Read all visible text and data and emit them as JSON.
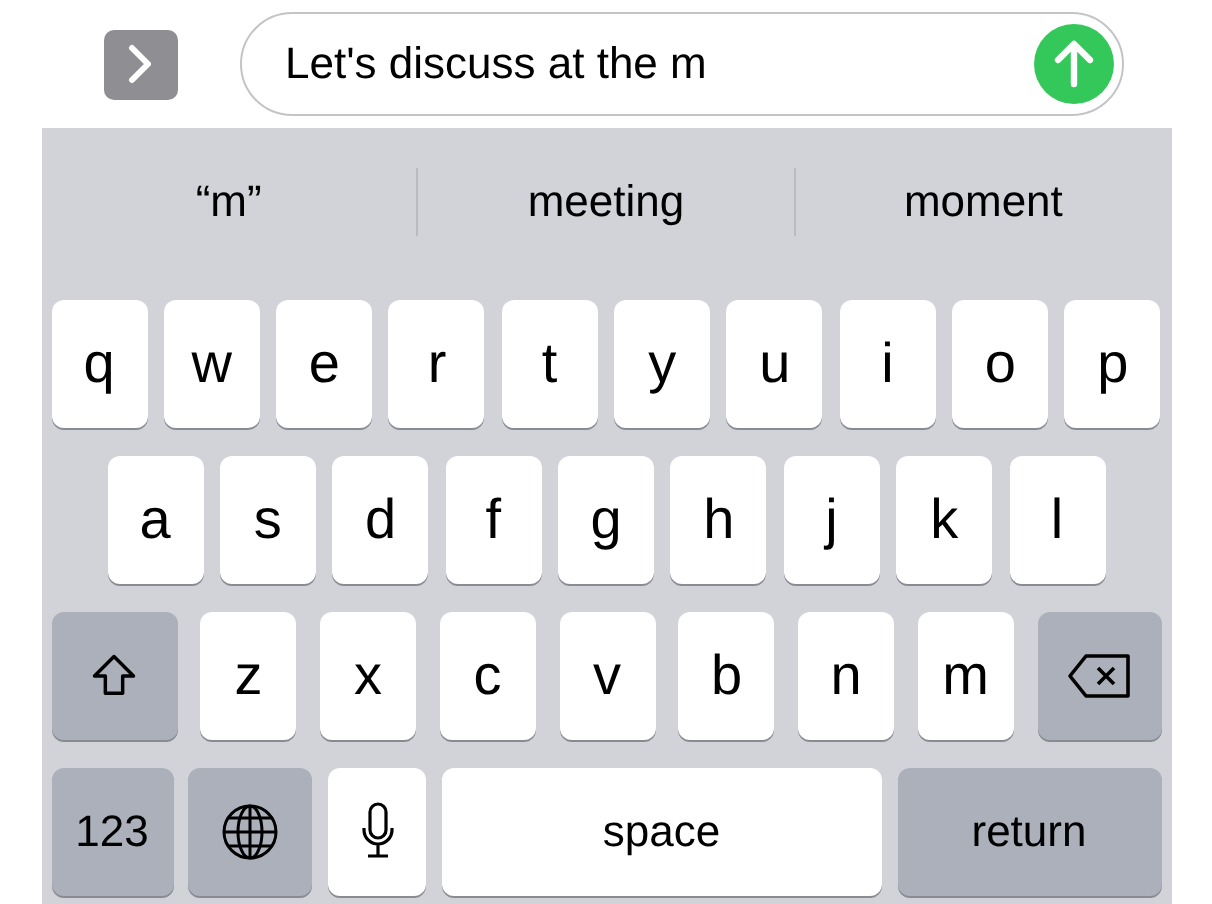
{
  "message_field": {
    "value": "Let's discuss at the m"
  },
  "suggestions": [
    {
      "label": "“m”"
    },
    {
      "label": "meeting"
    },
    {
      "label": "moment"
    }
  ],
  "keyboard_rows": [
    [
      {
        "kind": "letter",
        "label": "q"
      },
      {
        "kind": "letter",
        "label": "w"
      },
      {
        "kind": "letter",
        "label": "e"
      },
      {
        "kind": "letter",
        "label": "r"
      },
      {
        "kind": "letter",
        "label": "t"
      },
      {
        "kind": "letter",
        "label": "y"
      },
      {
        "kind": "letter",
        "label": "u"
      },
      {
        "kind": "letter",
        "label": "i"
      },
      {
        "kind": "letter",
        "label": "o"
      },
      {
        "kind": "letter",
        "label": "p"
      }
    ],
    [
      {
        "kind": "letter",
        "label": "a"
      },
      {
        "kind": "letter",
        "label": "s"
      },
      {
        "kind": "letter",
        "label": "d"
      },
      {
        "kind": "letter",
        "label": "f"
      },
      {
        "kind": "letter",
        "label": "g"
      },
      {
        "kind": "letter",
        "label": "h"
      },
      {
        "kind": "letter",
        "label": "j"
      },
      {
        "kind": "letter",
        "label": "k"
      },
      {
        "kind": "letter",
        "label": "l"
      }
    ],
    [
      {
        "kind": "shift"
      },
      {
        "kind": "letter",
        "label": "z"
      },
      {
        "kind": "letter",
        "label": "x"
      },
      {
        "kind": "letter",
        "label": "c"
      },
      {
        "kind": "letter",
        "label": "v"
      },
      {
        "kind": "letter",
        "label": "b"
      },
      {
        "kind": "letter",
        "label": "n"
      },
      {
        "kind": "letter",
        "label": "m"
      },
      {
        "kind": "delete"
      }
    ],
    [
      {
        "kind": "numbers",
        "label": "123"
      },
      {
        "kind": "globe"
      },
      {
        "kind": "mic"
      },
      {
        "kind": "space",
        "label": "space"
      },
      {
        "kind": "return",
        "label": "return"
      }
    ]
  ]
}
